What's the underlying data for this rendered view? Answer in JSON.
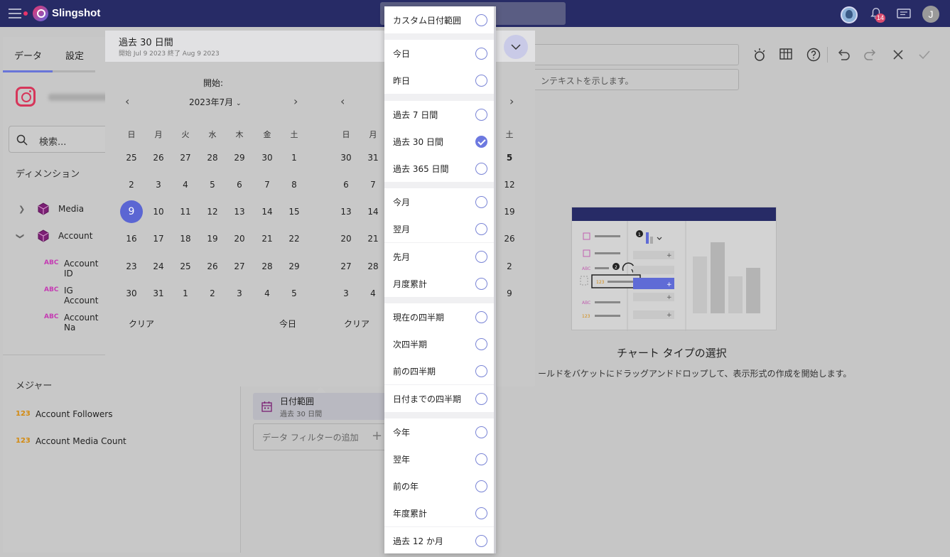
{
  "app": {
    "brand": "Slingshot"
  },
  "topbar": {
    "notifications_count": "14",
    "user_initial": "J"
  },
  "left": {
    "tabs": {
      "data": "データ",
      "settings": "設定"
    },
    "search_placeholder": "検索...",
    "dimensions_label": "ディメンション",
    "tree": [
      {
        "label": "Media",
        "expanded": false
      },
      {
        "label": "Account",
        "expanded": true
      }
    ],
    "fields": [
      "Account ID",
      "IG Account",
      "Account Na"
    ],
    "measures_label": "メジャー",
    "measures": [
      "Account Followers",
      "Account Media Count"
    ]
  },
  "workspace": {
    "description_placeholder": "ンテキストを示します。",
    "chart_type_title": "チャート タイプの選択",
    "chart_type_desc": "ールドをバケットにドラッグアンドドロップして、表示形式の作成を開始します。",
    "filter": {
      "title": "日付範囲",
      "value": "過去 30 日間"
    },
    "add_filter": "データ フィルターの追加"
  },
  "popup": {
    "title": "過去 30 日間",
    "subtitle": "開始 Jul 9 2023 終了 Aug 9 2023",
    "start_label": "開始:",
    "month": "2023年7月",
    "weekdays": [
      "日",
      "月",
      "火",
      "水",
      "木",
      "金",
      "土"
    ],
    "days": [
      [
        "25",
        "26",
        "27",
        "28",
        "29",
        "30",
        "1"
      ],
      [
        "2",
        "3",
        "4",
        "5",
        "6",
        "7",
        "8"
      ],
      [
        "9",
        "10",
        "11",
        "12",
        "13",
        "14",
        "15"
      ],
      [
        "16",
        "17",
        "18",
        "19",
        "20",
        "21",
        "22"
      ],
      [
        "23",
        "24",
        "25",
        "26",
        "27",
        "28",
        "29"
      ],
      [
        "30",
        "31",
        "1",
        "2",
        "3",
        "4",
        "5"
      ]
    ],
    "selected_day": "9",
    "clear_label": "クリア",
    "today_label": "今日",
    "second_weekdays": [
      "日",
      "月"
    ],
    "second_days": [
      [
        "30",
        "31"
      ],
      [
        "6",
        "7"
      ],
      [
        "13",
        "14"
      ],
      [
        "20",
        "21"
      ],
      [
        "27",
        "28"
      ],
      [
        "3",
        "4"
      ]
    ],
    "right_col_dow": "土",
    "right_col_days": [
      "5",
      "12",
      "19",
      "26",
      "2",
      "9"
    ]
  },
  "presets": {
    "groups": [
      [
        {
          "label": "カスタム日付範囲",
          "checked": false
        }
      ],
      [
        {
          "label": "今日",
          "checked": false
        },
        {
          "label": "昨日",
          "checked": false
        }
      ],
      [
        {
          "label": "過去 7 日間",
          "checked": false
        },
        {
          "label": "過去 30 日間",
          "checked": true
        },
        {
          "label": "過去 365 日間",
          "checked": false
        }
      ],
      [
        {
          "label": "今月",
          "checked": false
        },
        {
          "label": "翌月",
          "checked": false
        },
        {
          "label": "先月",
          "checked": false
        },
        {
          "label": "月度累計",
          "checked": false
        }
      ],
      [
        {
          "label": "現在の四半期",
          "checked": false
        },
        {
          "label": "次四半期",
          "checked": false
        },
        {
          "label": "前の四半期",
          "checked": false
        },
        {
          "label": "日付までの四半期",
          "checked": false
        }
      ],
      [
        {
          "label": "今年",
          "checked": false
        },
        {
          "label": "翌年",
          "checked": false
        },
        {
          "label": "前の年",
          "checked": false
        },
        {
          "label": "年度累計",
          "checked": false
        },
        {
          "label": "過去 12 か月",
          "checked": false
        }
      ]
    ]
  }
}
